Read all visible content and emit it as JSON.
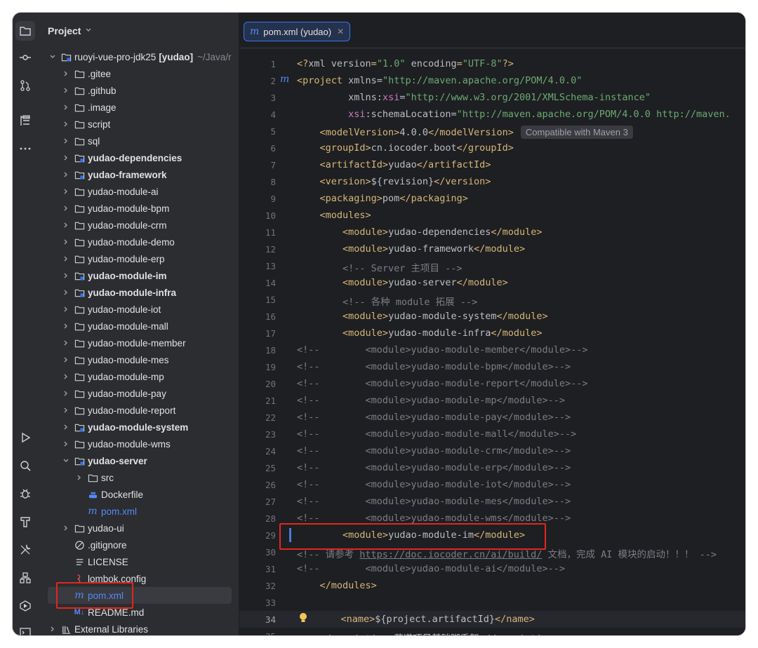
{
  "project_panel": {
    "title": "Project"
  },
  "tree": [
    {
      "label": "ruoyi-vue-pro-jdk25",
      "suffix": "[yudao]",
      "path": "~/Java/r",
      "indent": 0,
      "type": "module",
      "open": true,
      "bold": false
    },
    {
      "label": ".gitee",
      "indent": 1,
      "type": "folder",
      "bold": false
    },
    {
      "label": ".github",
      "indent": 1,
      "type": "folder",
      "bold": false
    },
    {
      "label": ".image",
      "indent": 1,
      "type": "folder",
      "bold": false
    },
    {
      "label": "script",
      "indent": 1,
      "type": "folder",
      "bold": false
    },
    {
      "label": "sql",
      "indent": 1,
      "type": "folder",
      "bold": false
    },
    {
      "label": "yudao-dependencies",
      "indent": 1,
      "type": "module",
      "bold": true
    },
    {
      "label": "yudao-framework",
      "indent": 1,
      "type": "module",
      "bold": true
    },
    {
      "label": "yudao-module-ai",
      "indent": 1,
      "type": "folder",
      "bold": false
    },
    {
      "label": "yudao-module-bpm",
      "indent": 1,
      "type": "folder",
      "bold": false
    },
    {
      "label": "yudao-module-crm",
      "indent": 1,
      "type": "folder",
      "bold": false
    },
    {
      "label": "yudao-module-demo",
      "indent": 1,
      "type": "folder",
      "bold": false
    },
    {
      "label": "yudao-module-erp",
      "indent": 1,
      "type": "folder",
      "bold": false
    },
    {
      "label": "yudao-module-im",
      "indent": 1,
      "type": "module",
      "bold": true
    },
    {
      "label": "yudao-module-infra",
      "indent": 1,
      "type": "module",
      "bold": true
    },
    {
      "label": "yudao-module-iot",
      "indent": 1,
      "type": "folder",
      "bold": false
    },
    {
      "label": "yudao-module-mall",
      "indent": 1,
      "type": "folder",
      "bold": false
    },
    {
      "label": "yudao-module-member",
      "indent": 1,
      "type": "folder",
      "bold": false
    },
    {
      "label": "yudao-module-mes",
      "indent": 1,
      "type": "folder",
      "bold": false
    },
    {
      "label": "yudao-module-mp",
      "indent": 1,
      "type": "folder",
      "bold": false
    },
    {
      "label": "yudao-module-pay",
      "indent": 1,
      "type": "folder",
      "bold": false
    },
    {
      "label": "yudao-module-report",
      "indent": 1,
      "type": "folder",
      "bold": false
    },
    {
      "label": "yudao-module-system",
      "indent": 1,
      "type": "module",
      "bold": true
    },
    {
      "label": "yudao-module-wms",
      "indent": 1,
      "type": "folder",
      "bold": false
    },
    {
      "label": "yudao-server",
      "indent": 1,
      "type": "module",
      "open": true,
      "bold": true
    },
    {
      "label": "src",
      "indent": 2,
      "type": "folder",
      "bold": false
    },
    {
      "label": "Dockerfile",
      "indent": 2,
      "type": "docker",
      "leaf": true,
      "bold": false
    },
    {
      "label": "pom.xml",
      "indent": 2,
      "type": "maven",
      "leaf": true,
      "blue": true,
      "bold": false
    },
    {
      "label": "yudao-ui",
      "indent": 1,
      "type": "folder",
      "bold": false
    },
    {
      "label": ".gitignore",
      "indent": 1,
      "type": "ignore",
      "leaf": true,
      "bold": false
    },
    {
      "label": "LICENSE",
      "indent": 1,
      "type": "text",
      "leaf": true,
      "bold": false
    },
    {
      "label": "lombok.config",
      "indent": 1,
      "type": "config",
      "leaf": true,
      "bold": false
    },
    {
      "label": "pom.xml",
      "indent": 1,
      "type": "maven",
      "leaf": true,
      "blue": true,
      "selected": true,
      "bold": false
    },
    {
      "label": "README.md",
      "indent": 1,
      "type": "md",
      "leaf": true,
      "bold": false
    },
    {
      "label": "External Libraries",
      "indent": 0,
      "type": "libs",
      "bold": false
    }
  ],
  "editor": {
    "tab": {
      "icon": "m",
      "label": "pom.xml (yudao)"
    },
    "hint": "Compatible with Maven 3",
    "current_line": 34,
    "lines": [
      {
        "n": "1",
        "t": [
          [
            "tag",
            "<?"
          ],
          [
            "attr",
            "xml version"
          ],
          [
            "tag",
            "="
          ],
          [
            "str",
            "\"1.0\""
          ],
          [
            "attr",
            " encoding"
          ],
          [
            "tag",
            "="
          ],
          [
            "str",
            "\"UTF-8\""
          ],
          [
            "tag",
            "?>"
          ]
        ]
      },
      {
        "n": "2",
        "t": [
          [
            "tag",
            "<project"
          ],
          [
            "attr",
            " xmlns"
          ],
          [
            "attr",
            "="
          ],
          [
            "str",
            "\"http://maven.apache.org/POM/4.0.0\""
          ]
        ]
      },
      {
        "n": "3",
        "t": [
          [
            "attr",
            "         xmlns"
          ],
          [
            "attr",
            ":"
          ],
          [
            "ns",
            "xsi"
          ],
          [
            "attr",
            "="
          ],
          [
            "str",
            "\"http://www.w3.org/2001/XMLSchema-instance\""
          ]
        ]
      },
      {
        "n": "4",
        "t": [
          [
            "attr",
            "         "
          ],
          [
            "ns",
            "xsi"
          ],
          [
            "attr",
            ":schemaLocation="
          ],
          [
            "str",
            "\"http://maven.apache.org/POM/4.0.0 http://maven."
          ]
        ]
      },
      {
        "n": "5",
        "t": [
          [
            "attr",
            "    "
          ],
          [
            "tag",
            "<modelVersion>"
          ],
          [
            "attr",
            "4.0.0"
          ],
          [
            "tag",
            "</modelVersion>"
          ]
        ],
        "hint": true
      },
      {
        "n": "6",
        "t": [
          [
            "attr",
            "    "
          ],
          [
            "tag",
            "<groupId>"
          ],
          [
            "attr",
            "cn.iocoder.boot"
          ],
          [
            "tag",
            "</groupId>"
          ]
        ]
      },
      {
        "n": "7",
        "t": [
          [
            "attr",
            "    "
          ],
          [
            "tag",
            "<artifactId>"
          ],
          [
            "attr",
            "yudao"
          ],
          [
            "tag",
            "</artifactId>"
          ]
        ]
      },
      {
        "n": "8",
        "t": [
          [
            "attr",
            "    "
          ],
          [
            "tag",
            "<version>"
          ],
          [
            "attr",
            "${revision}"
          ],
          [
            "tag",
            "</version>"
          ]
        ]
      },
      {
        "n": "9",
        "t": [
          [
            "attr",
            "    "
          ],
          [
            "tag",
            "<packaging>"
          ],
          [
            "attr",
            "pom"
          ],
          [
            "tag",
            "</packaging>"
          ]
        ]
      },
      {
        "n": "10",
        "t": [
          [
            "attr",
            "    "
          ],
          [
            "tag",
            "<modules>"
          ]
        ]
      },
      {
        "n": "11",
        "t": [
          [
            "attr",
            "        "
          ],
          [
            "tag",
            "<module>"
          ],
          [
            "attr",
            "yudao-dependencies"
          ],
          [
            "tag",
            "</module>"
          ]
        ]
      },
      {
        "n": "12",
        "t": [
          [
            "attr",
            "        "
          ],
          [
            "tag",
            "<module>"
          ],
          [
            "attr",
            "yudao-framework"
          ],
          [
            "tag",
            "</module>"
          ]
        ]
      },
      {
        "n": "13",
        "t": [
          [
            "cmt",
            "        <!-- Server 主项目 -->"
          ]
        ]
      },
      {
        "n": "14",
        "t": [
          [
            "attr",
            "        "
          ],
          [
            "tag",
            "<module>"
          ],
          [
            "attr",
            "yudao-server"
          ],
          [
            "tag",
            "</module>"
          ]
        ]
      },
      {
        "n": "15",
        "t": [
          [
            "cmt",
            "        <!-- 各种 module 拓展 -->"
          ]
        ]
      },
      {
        "n": "16",
        "t": [
          [
            "attr",
            "        "
          ],
          [
            "tag",
            "<module>"
          ],
          [
            "attr",
            "yudao-module-system"
          ],
          [
            "tag",
            "</module>"
          ]
        ]
      },
      {
        "n": "17",
        "t": [
          [
            "attr",
            "        "
          ],
          [
            "tag",
            "<module>"
          ],
          [
            "attr",
            "yudao-module-infra"
          ],
          [
            "tag",
            "</module>"
          ]
        ]
      },
      {
        "n": "18",
        "t": [
          [
            "cmt",
            "<!--        <module>yudao-module-member</module>-->"
          ]
        ]
      },
      {
        "n": "19",
        "t": [
          [
            "cmt",
            "<!--        <module>yudao-module-bpm</module>-->"
          ]
        ]
      },
      {
        "n": "20",
        "t": [
          [
            "cmt",
            "<!--        <module>yudao-module-report</module>-->"
          ]
        ]
      },
      {
        "n": "21",
        "t": [
          [
            "cmt",
            "<!--        <module>yudao-module-mp</module>-->"
          ]
        ]
      },
      {
        "n": "22",
        "t": [
          [
            "cmt",
            "<!--        <module>yudao-module-pay</module>-->"
          ]
        ]
      },
      {
        "n": "23",
        "t": [
          [
            "cmt",
            "<!--        <module>yudao-module-mall</module>-->"
          ]
        ]
      },
      {
        "n": "24",
        "t": [
          [
            "cmt",
            "<!--        <module>yudao-module-crm</module>-->"
          ]
        ]
      },
      {
        "n": "25",
        "t": [
          [
            "cmt",
            "<!--        <module>yudao-module-erp</module>-->"
          ]
        ]
      },
      {
        "n": "26",
        "t": [
          [
            "cmt",
            "<!--        <module>yudao-module-iot</module>-->"
          ]
        ]
      },
      {
        "n": "27",
        "t": [
          [
            "cmt",
            "<!--        <module>yudao-module-mes</module>-->"
          ]
        ]
      },
      {
        "n": "28",
        "t": [
          [
            "cmt",
            "<!--        <module>yudao-module-wms</module>-->"
          ]
        ]
      },
      {
        "n": "29",
        "t": [
          [
            "attr",
            "        "
          ],
          [
            "tag",
            "<module>"
          ],
          [
            "attr",
            "yudao-module-im"
          ],
          [
            "tag",
            "</module>"
          ]
        ]
      },
      {
        "n": "30",
        "t": [
          [
            "cmt",
            "<!-- 请参考 "
          ],
          [
            "link",
            "https://doc.iocoder.cn/ai/build/"
          ],
          [
            "cmt",
            " 文档，完成 AI 模块的启动！！！ -->"
          ]
        ]
      },
      {
        "n": "31",
        "t": [
          [
            "cmt",
            "<!--        <module>yudao-module-ai</module>-->"
          ]
        ]
      },
      {
        "n": "32",
        "t": [
          [
            "attr",
            "    "
          ],
          [
            "tag",
            "</modules>"
          ]
        ]
      },
      {
        "n": "33",
        "t": []
      },
      {
        "n": "34",
        "t": [
          [
            "attr",
            "    "
          ],
          [
            "tag",
            "<name>"
          ],
          [
            "attr",
            "${project.artifactId}"
          ],
          [
            "tag",
            "</name>"
          ]
        ]
      },
      {
        "n": "35",
        "t": [
          [
            "attr",
            "    "
          ],
          [
            "tag",
            "<description>"
          ],
          [
            "attr",
            "芋道项目基础脚手架"
          ],
          [
            "tag",
            "</description>"
          ]
        ]
      }
    ]
  }
}
